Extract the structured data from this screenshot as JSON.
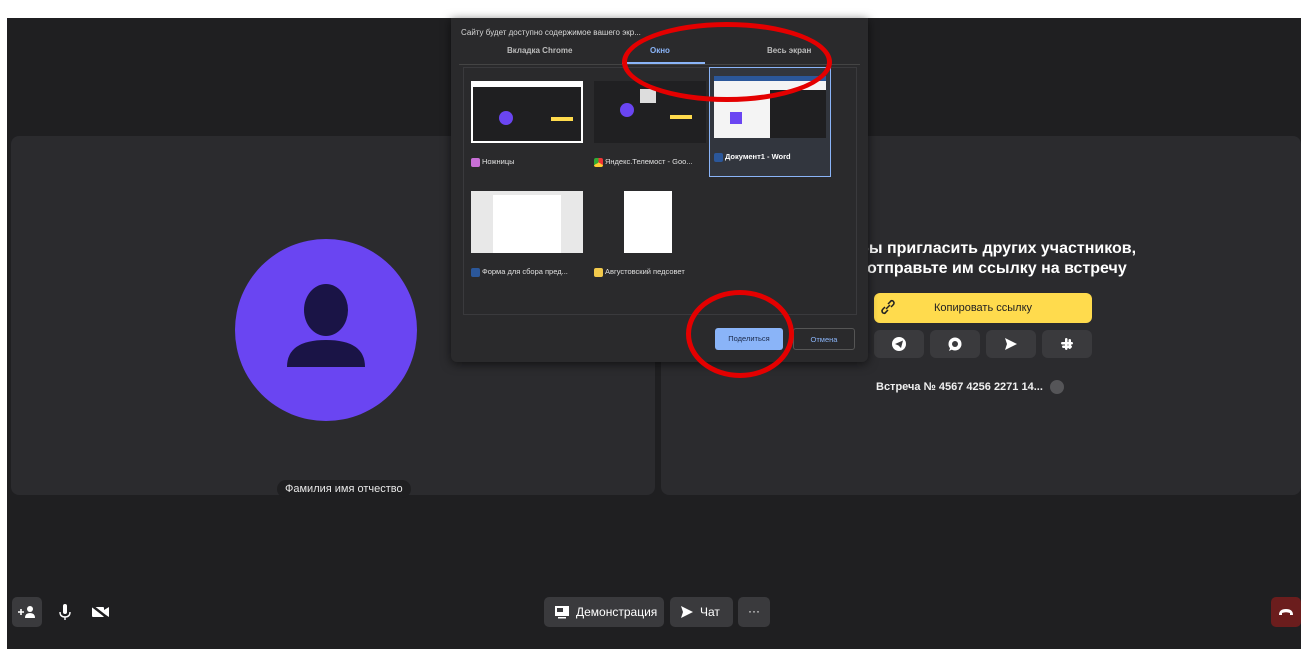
{
  "participant": {
    "name": "Фамилия имя отчество",
    "avatar_color": "#6a45f2"
  },
  "invite": {
    "line1": "бы пригласить других участников,",
    "line2": "отправьте им ссылку на встречу",
    "copy_button": "Копировать ссылку",
    "share_icons": [
      "telegram-icon",
      "whatsapp-icon",
      "send-icon",
      "slack-icon"
    ],
    "meeting_id": "Встреча № 4567 4256 2271 14..."
  },
  "dialog": {
    "title": "Сайту будет доступно содержимое вашего экр...",
    "tabs": [
      {
        "label": "Вкладка Chrome",
        "active": false
      },
      {
        "label": "Окно",
        "active": true
      },
      {
        "label": "Весь экран",
        "active": false
      }
    ],
    "windows": [
      {
        "label": "Ножницы",
        "icon": "scissors-app-icon",
        "selected": false
      },
      {
        "label": "Яндекс.Телемост - Goo...",
        "icon": "chrome-icon",
        "selected": false
      },
      {
        "label": "Документ1 - Word",
        "icon": "word-icon",
        "selected": true
      },
      {
        "label": "Форма для сбора пред...",
        "icon": "word-icon",
        "selected": false
      },
      {
        "label": "Августовский педсовет",
        "icon": "folder-icon",
        "selected": false
      }
    ],
    "share_button": "Поделиться",
    "cancel_button": "Отмена"
  },
  "toolbar": {
    "demo_button": "Демонстрация",
    "chat_button": "Чат",
    "more_button": "···"
  },
  "colors": {
    "background": "#1f1f21",
    "tile": "#2b2b2e",
    "accent_yellow": "#ffdb4d",
    "accent_blue": "#8ab4f8",
    "annotation_red": "#e40000",
    "hangup": "#6b1d1d"
  }
}
